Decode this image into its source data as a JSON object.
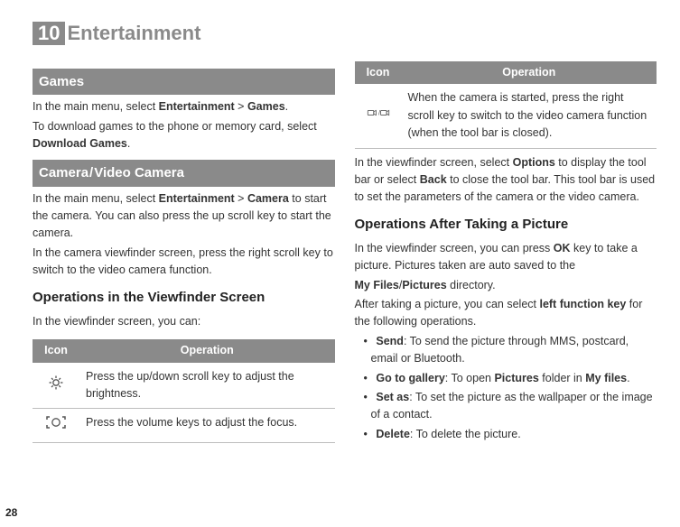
{
  "chapter": {
    "number": "10",
    "title": "Entertainment"
  },
  "left": {
    "games": {
      "bar": "Games",
      "p1a": "In the main menu, select ",
      "p1b": "Entertainment",
      "p1c": " > ",
      "p1d": "Games",
      "p1e": ".",
      "p2a": "To download games to the phone or memory card, select ",
      "p2b": "Download Games",
      "p2c": "."
    },
    "camera": {
      "bar1": "Camera",
      "barSep": "/",
      "bar2": "Video Camera",
      "p1a": "In the main menu, select ",
      "p1b": "Entertainment",
      "p1c": " > ",
      "p1d": "Camera",
      "p1e": " to start the camera. You can also press the up scroll key to start the camera.",
      "p2": "In the camera viewfinder screen, press the right scroll key to switch to the video camera function.",
      "sub": "Operations in the Viewfinder Screen",
      "intro": "In the viewfinder screen, you can:"
    },
    "table": {
      "h1": "Icon",
      "h2": "Operation",
      "rows": [
        {
          "name": "brightness-icon",
          "op": "Press the up/down scroll key to adjust the brightness."
        },
        {
          "name": "focus-icon",
          "op": " Press the volume keys to adjust the focus."
        }
      ]
    }
  },
  "right": {
    "table": {
      "h1": "Icon",
      "h2": "Operation",
      "rows": [
        {
          "name": "video-camera-toggle-icon",
          "op": "When the camera is started, press the right scroll key to switch to the video camera function (when the tool bar is closed)."
        }
      ]
    },
    "p1a": "In the viewfinder screen, select ",
    "p1b": "Options",
    "p1c": " to display the tool bar or select ",
    "p1d": "Back",
    "p1e": " to close the tool bar. This tool bar is used to set the parameters of the camera or the video camera.",
    "sub": "Operations After Taking a Picture",
    "p2a": "In the viewfinder screen, you can press ",
    "p2b": "OK",
    "p2c": " key to take a picture. Pictures taken are auto saved to the",
    "p3a": "My Files",
    "p3b": "/",
    "p3c": "Pictures",
    "p3d": " directory.",
    "p4a": "After taking a picture, you can select ",
    "p4b": "left function key",
    "p4c": " for the following operations.",
    "bullets": [
      {
        "b": "Send",
        "t": ": To send the picture through MMS, postcard, email or Bluetooth."
      },
      {
        "b": "Go to gallery",
        "t1": ": To open ",
        "b2": "Pictures",
        "t2": " folder in ",
        "b3": "My files",
        "t3": "."
      },
      {
        "b": "Set as",
        "t": ": To set the picture as the wallpaper or the image of a contact."
      },
      {
        "b": "Delete",
        "t": ": To delete the picture."
      }
    ]
  },
  "pageNumber": "28"
}
